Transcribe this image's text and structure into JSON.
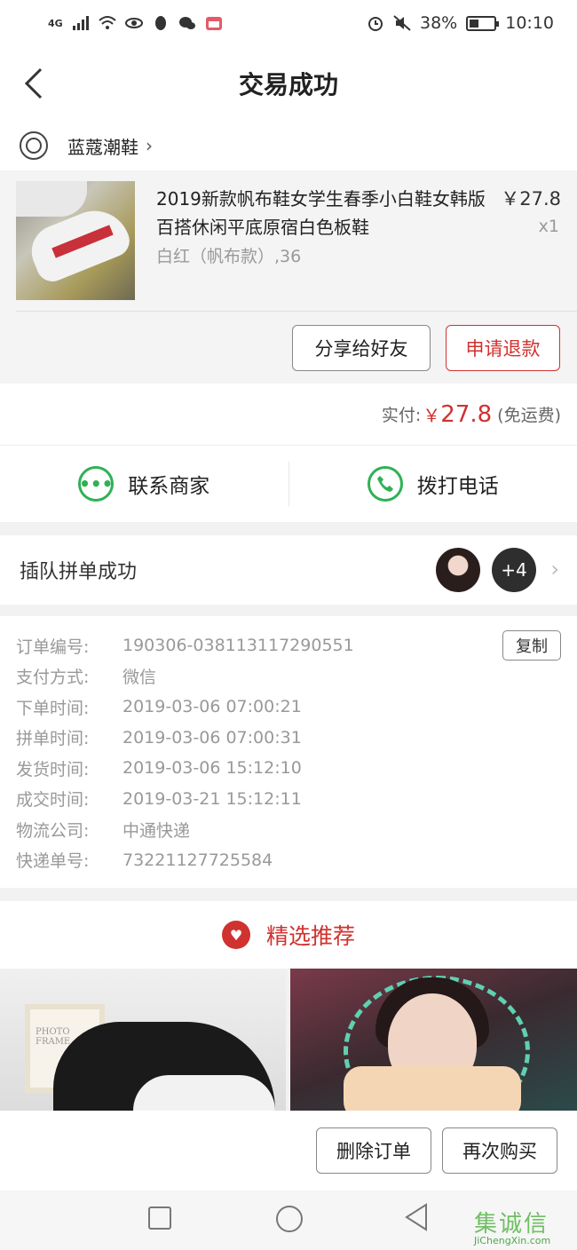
{
  "status_bar": {
    "signal": "4G",
    "battery_percent_text": "38%",
    "battery_level": 0.38,
    "time": "10:10",
    "icons": [
      "signal-icon",
      "wifi-icon",
      "eye-icon",
      "qq-icon",
      "wechat-icon",
      "calendar-icon",
      "alarm-icon",
      "mute-icon",
      "battery-icon"
    ]
  },
  "header": {
    "title": "交易成功"
  },
  "shop": {
    "name": "蓝蔻潮鞋",
    "arrow": "›"
  },
  "product": {
    "title": "2019新款帆布鞋女学生春季小白鞋女韩版百搭休闲平底原宿白色板鞋",
    "price": "￥27.8",
    "quantity": "x1",
    "sku": "白红（帆布款）,36",
    "share_label": "分享给好友",
    "refund_label": "申请退款"
  },
  "payment": {
    "label": "实付:",
    "currency": "￥",
    "amount": "27.8",
    "note": "(免运费)"
  },
  "contact": {
    "merchant_label": "联系商家",
    "phone_label": "拨打电话"
  },
  "group": {
    "label": "插队拼单成功",
    "more_count": "+4",
    "arrow": "›"
  },
  "order_details": {
    "copy_label": "复制",
    "rows": [
      {
        "label": "订单编号:",
        "value": "190306-038113117290551"
      },
      {
        "label": "支付方式:",
        "value": "微信"
      },
      {
        "label": "下单时间:",
        "value": "2019-03-06 07:00:21"
      },
      {
        "label": "拼单时间:",
        "value": "2019-03-06 07:00:31"
      },
      {
        "label": "发货时间:",
        "value": "2019-03-06 15:12:10"
      },
      {
        "label": "成交时间:",
        "value": "2019-03-21 15:12:11"
      },
      {
        "label": "物流公司:",
        "value": "中通快递"
      },
      {
        "label": "快递单号:",
        "value": "73221127725584"
      }
    ]
  },
  "recommend": {
    "title": "精选推荐",
    "frame_text": "PHOTO FRAME"
  },
  "actions": {
    "delete_label": "删除订单",
    "rebuy_label": "再次购买"
  },
  "watermark": {
    "top": "集诚信",
    "bottom": "JiChengXin.com"
  },
  "colors": {
    "accent_red": "#d0322f",
    "wechat_green": "#2fb155"
  }
}
